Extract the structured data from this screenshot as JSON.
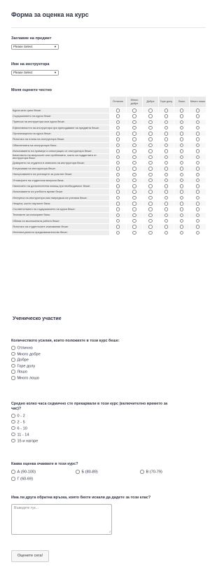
{
  "form": {
    "title": "Форма за оценка на курс",
    "subject": {
      "label": "Заглавие на предмет",
      "value": "Please Select"
    },
    "instructor": {
      "label": "Име на инструктора",
      "value": "Please Select"
    },
    "matrix": {
      "heading": "Моля оценете честно",
      "columns": [
        "Отлично",
        "Много добре",
        "Добре",
        "Горе долу",
        "Лошо",
        "Много лошо"
      ],
      "rows": [
        "Курса като цяло беше:",
        "Съдържанието на курса беше:",
        "Приноса на инструктора към курса беше:",
        "Ефективността на инструктора при преподаване на предмета беше:",
        "Организацията на курса беше:",
        "Яснотата на плана на инструктора беше:",
        "Обясненията на инструктора бяха:",
        "Използването на примери и илюстрации от инструктора беше:",
        "Качеството на въпросите или проблемите, които са поддигнати от инструктора бяха:",
        "Доверието на студента в знанията на инструктора беше:",
        "Ентусиазма на инструктора беше:",
        "Насърчаването на учениците за участие беше:",
        "Отговорите на студентски въпроси бяха:",
        "Наличието на допълнителна помощ при необходимост беше:",
        "Използването на учебното време беше:",
        "Интереса на инструктора към напредъка на ученика беше:",
        "Нещата, които научихте бяха:",
        "Съответствието на съдържанието на курса беше:",
        "Техниките за класиране бяха:",
        "Обема на възложената работа беше:",
        "Яснотата на студентските изисквания беше:",
        "Интелектуалното предизвикателство беше:"
      ]
    },
    "participation": {
      "heading": "Ученическо участие",
      "effort": {
        "label": "Количеството усилия, които положихте в този курс беше:",
        "options": [
          "Отлично",
          "Много добре",
          "Добре",
          "Горе долу",
          "Лошо",
          "Много лошо"
        ]
      },
      "hours": {
        "label_line1": "Средно колко часа седмично сте прекарвали в този курс (включително времето за",
        "label_line2": "час)?",
        "options": [
          "0 - 2",
          "2 - 5",
          "6 - 10",
          "11 - 14",
          "15 и нагоре"
        ]
      },
      "grade": {
        "label": "Каква оценка очаквате в този курс?",
        "options": [
          "А (90-100)",
          "Б (80-89)",
          "В (70-79)",
          "Г (60-69)"
        ]
      },
      "feedback": {
        "label": "Има ли друга обратна връзка, която бихте искали да дадете за този клас?",
        "placeholder": "Въведете тук..."
      }
    },
    "submit_label": "Оценете сега!"
  }
}
